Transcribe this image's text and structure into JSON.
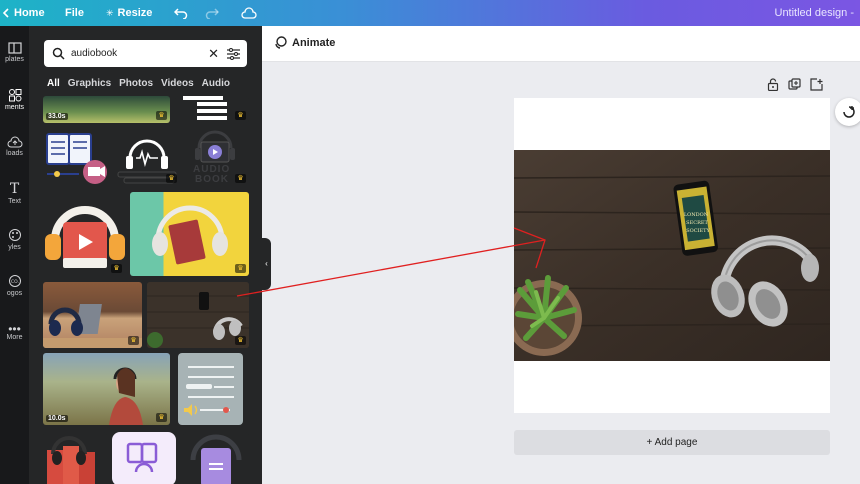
{
  "topbar": {
    "home": "Home",
    "file": "File",
    "resize": "Resize",
    "title": "Untitled design -"
  },
  "rail": {
    "items": [
      {
        "label": "plates",
        "icon": "templates-icon"
      },
      {
        "label": "ments",
        "icon": "elements-icon"
      },
      {
        "label": "loads",
        "icon": "uploads-icon"
      },
      {
        "label": "Text",
        "icon": "text-icon"
      },
      {
        "label": "yles",
        "icon": "styles-icon"
      },
      {
        "label": "ogos",
        "icon": "logos-icon"
      },
      {
        "label": "More",
        "icon": "more-icon"
      }
    ]
  },
  "search": {
    "value": "audiobook"
  },
  "tabs": [
    "All",
    "Graphics",
    "Photos",
    "Videos",
    "Audio"
  ],
  "results": {
    "durations": [
      "33.0s",
      "10.0s"
    ],
    "audio_book_word_1": "AUDIO",
    "audio_book_word_2": "BOOK",
    "phone_book_lines": [
      "LONDON",
      "SECRET",
      "SOCIETY"
    ]
  },
  "editor": {
    "animate": "Animate",
    "add_page": "+ Add page"
  },
  "colors": {
    "annotation_arrow": "#e02020",
    "panel_bg": "#252627",
    "accent": "#8b5cf6"
  }
}
